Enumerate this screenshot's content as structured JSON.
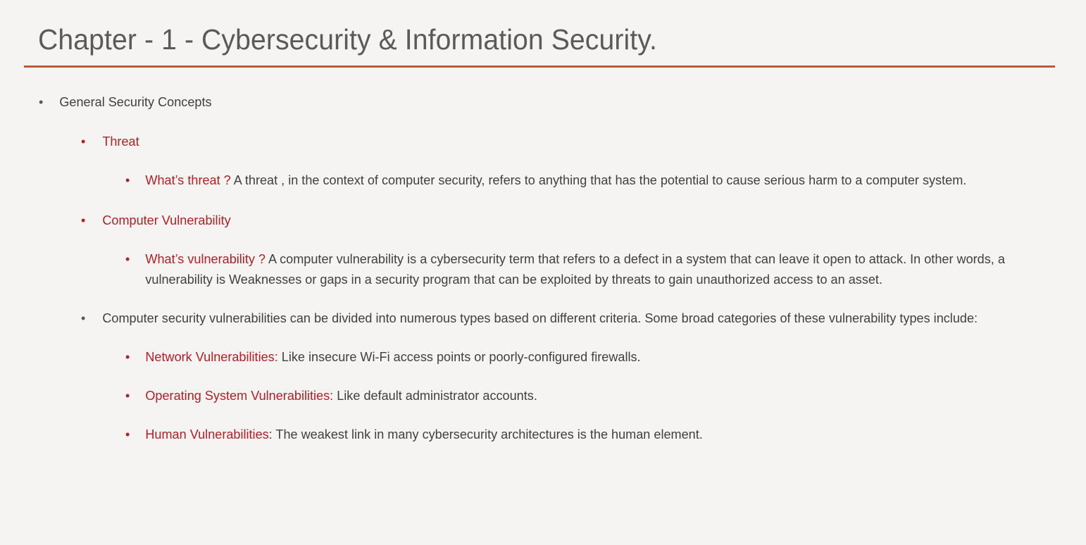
{
  "slide": {
    "title": "Chapter - 1 - Cybersecurity & Information Security.",
    "background_color": "#F5F4F2",
    "title_color": "#5A5A5A",
    "rule_color": "#C0563A",
    "accent_color": "#B22025",
    "body_color": "#404040",
    "bullet_glyph": "•"
  },
  "content": {
    "b1": {
      "text": "General Security Concepts"
    },
    "b2": {
      "text": "Threat"
    },
    "b3": {
      "lead": "What’s threat ?",
      "body": " A threat , in the context of computer security, refers to anything that has the potential to cause serious harm to a computer system."
    },
    "b4": {
      "text": "Computer Vulnerability"
    },
    "b5": {
      "lead": "What’s vulnerability ?",
      "body": " A computer vulnerability is a cybersecurity term that refers to a defect in a system that can leave it open to attack. In other words, a vulnerability is Weaknesses or gaps in a security program that can be exploited by threats to gain unauthorized access to an asset."
    },
    "b6": {
      "text": "Computer security vulnerabilities can be divided into numerous types based on different criteria. Some broad categories of these vulnerability types include:"
    },
    "b7": {
      "lead": "Network Vulnerabilities:",
      "body": " Like insecure Wi-Fi access points or poorly-configured firewalls."
    },
    "b8": {
      "lead": "Operating System Vulnerabilities:",
      "body": " Like default administrator accounts."
    },
    "b9": {
      "lead": "Human Vulnerabilities:",
      "body": " The weakest link in many cybersecurity architectures is the human element."
    }
  }
}
